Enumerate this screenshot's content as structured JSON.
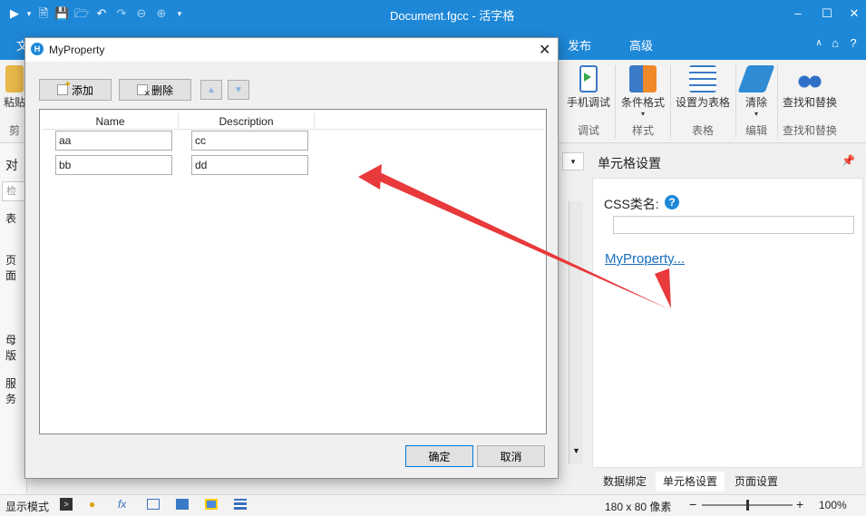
{
  "window": {
    "title": "Document.fgcc - 活字格"
  },
  "ribbon_tabs": {
    "file_partial": "文",
    "publish": "发布",
    "advanced": "高级"
  },
  "ribbon": {
    "paste_partial": "粘贴",
    "clipboard_partial": "剪",
    "mobile_debug": "手机调试",
    "debug_caption": "调试",
    "conditional_format": "条件格式",
    "style_caption": "样式",
    "set_as_table": "设置为表格",
    "table_caption": "表格",
    "clear": "清除",
    "edit_caption": "编辑",
    "find_replace": "查找和替换",
    "find_replace_caption": "查找和替换"
  },
  "left_panel": {
    "header_partial": "对",
    "search_partial": "检索",
    "table_label": "表",
    "page_label": "页面",
    "master_label": "母版",
    "service_label": "服务"
  },
  "dialog": {
    "title": "MyProperty",
    "add_label": "添加",
    "delete_label": "删除",
    "columns": [
      "Name",
      "Description"
    ],
    "rows": [
      [
        "aa",
        "cc"
      ],
      [
        "bb",
        "dd"
      ]
    ],
    "ok_label": "确定",
    "cancel_label": "取消"
  },
  "right_panel": {
    "title": "单元格设置",
    "css_label": "CSS类名:",
    "css_value": "",
    "link_label": "MyProperty...",
    "tabs": [
      "数据绑定",
      "单元格设置",
      "页面设置"
    ],
    "active_tab_index": 1
  },
  "statusbar": {
    "mode_label": "显示模式",
    "size_label": "180 x 80 像素",
    "zoom": "100%",
    "zoom_fraction": 0.5
  },
  "colors": {
    "accent": "#1e88d8",
    "arrow": "#e8393b",
    "link": "#1a6fc0"
  }
}
